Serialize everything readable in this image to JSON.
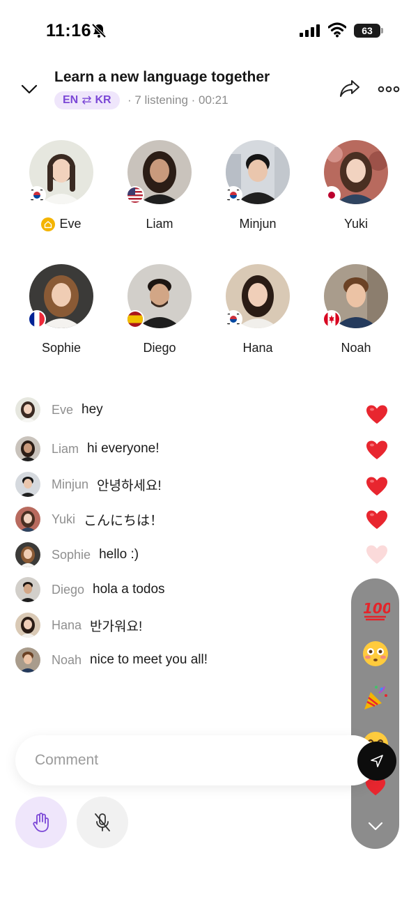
{
  "status_bar": {
    "time": "11:16",
    "battery_level": "63",
    "icons": [
      "bell-slash-icon",
      "signal-icon",
      "wifi-icon",
      "battery-icon"
    ]
  },
  "header": {
    "title": "Learn a new language together",
    "lang_from": "EN",
    "lang_swap": "⇄",
    "lang_to": "KR",
    "meta": "· 7 listening · 00:21",
    "icons": [
      "chevron-down-icon",
      "share-icon",
      "more-icon"
    ]
  },
  "speakers": [
    {
      "name": "Eve",
      "flag": "korea",
      "host": true
    },
    {
      "name": "Liam",
      "flag": "usa"
    },
    {
      "name": "Minjun",
      "flag": "korea"
    },
    {
      "name": "Yuki",
      "flag": "japan"
    },
    {
      "name": "Sophie",
      "flag": "france"
    },
    {
      "name": "Diego",
      "flag": "spain"
    },
    {
      "name": "Hana",
      "flag": "korea"
    },
    {
      "name": "Noah",
      "flag": "canada"
    }
  ],
  "chat": [
    {
      "user": "Eve",
      "text": "hey"
    },
    {
      "user": "Liam",
      "text": "hi everyone!"
    },
    {
      "user": "Minjun",
      "text": "안녕하세요!"
    },
    {
      "user": "Yuki",
      "text": "こんにちは！"
    },
    {
      "user": "Sophie",
      "text": "hello :)"
    },
    {
      "user": "Diego",
      "text": "hola a todos"
    },
    {
      "user": "Hana",
      "text": "반가워요!"
    },
    {
      "user": "Noah",
      "text": "nice to meet you all!"
    }
  ],
  "reactions": [
    "hundred-points-icon",
    "flushed-face-icon",
    "party-popper-icon",
    "smiling-face-icon",
    "heart-icon",
    "chevron-down-icon"
  ],
  "comment": {
    "placeholder": "Comment"
  },
  "colors": {
    "accent": "#7b47d6",
    "accent_bg": "#efe6fb",
    "heart": "#e8262f",
    "tray": "#8c8c8c"
  }
}
